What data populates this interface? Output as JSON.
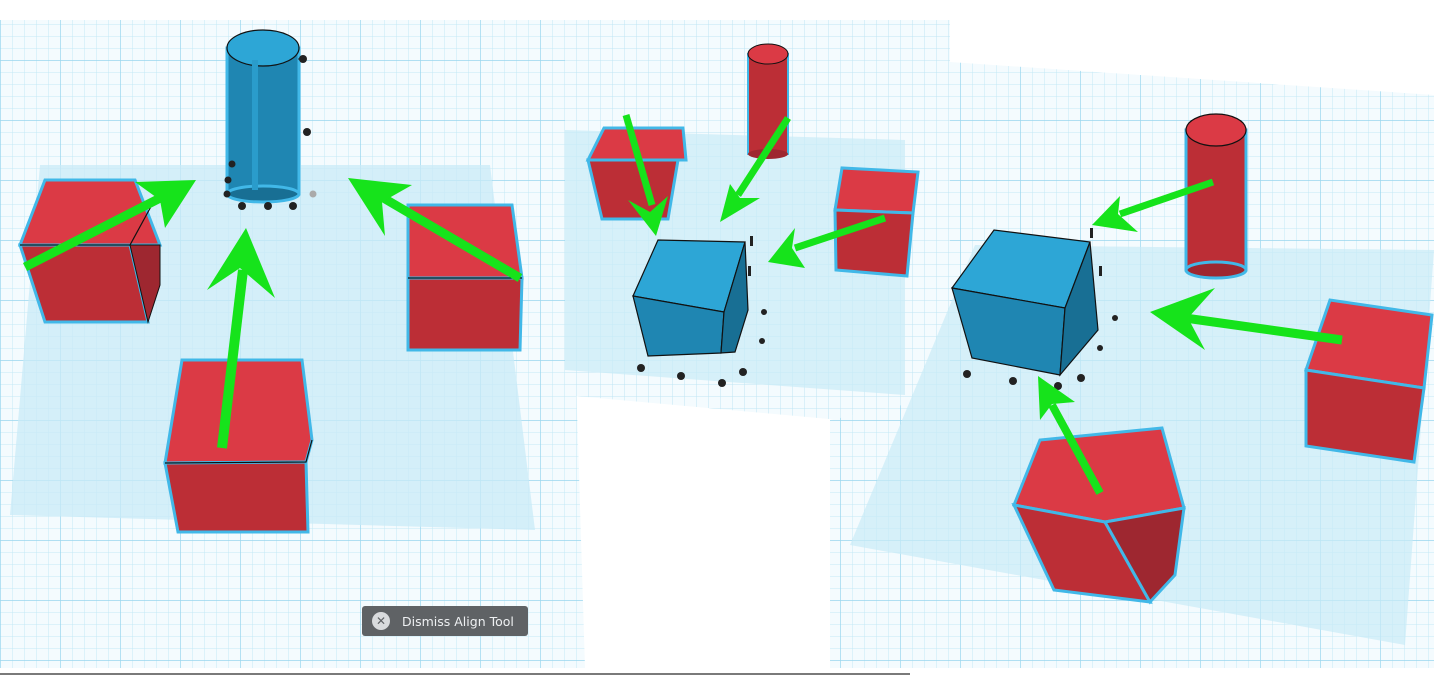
{
  "align_tool": {
    "dismiss_label": "Dismiss Align Tool"
  },
  "icons": {
    "dismiss": "close-icon"
  },
  "colors": {
    "grid_background": "#f4fbfe",
    "grid_line": "#bfe6f4",
    "grid_major_line": "#8fd2ec",
    "selection_plane": "#c9ebf7",
    "selection_outline": "#41b8e8",
    "red_face_top": "#db3a45",
    "red_face_front": "#bc2e36",
    "red_face_side": "#9e2730",
    "blue_face_top": "#2da6d6",
    "blue_face_front": "#1f86b2",
    "blue_face_side": "#186f94",
    "arrow": "#16e31b",
    "handle": "#222222",
    "dismiss_bg": "#5f6265"
  }
}
